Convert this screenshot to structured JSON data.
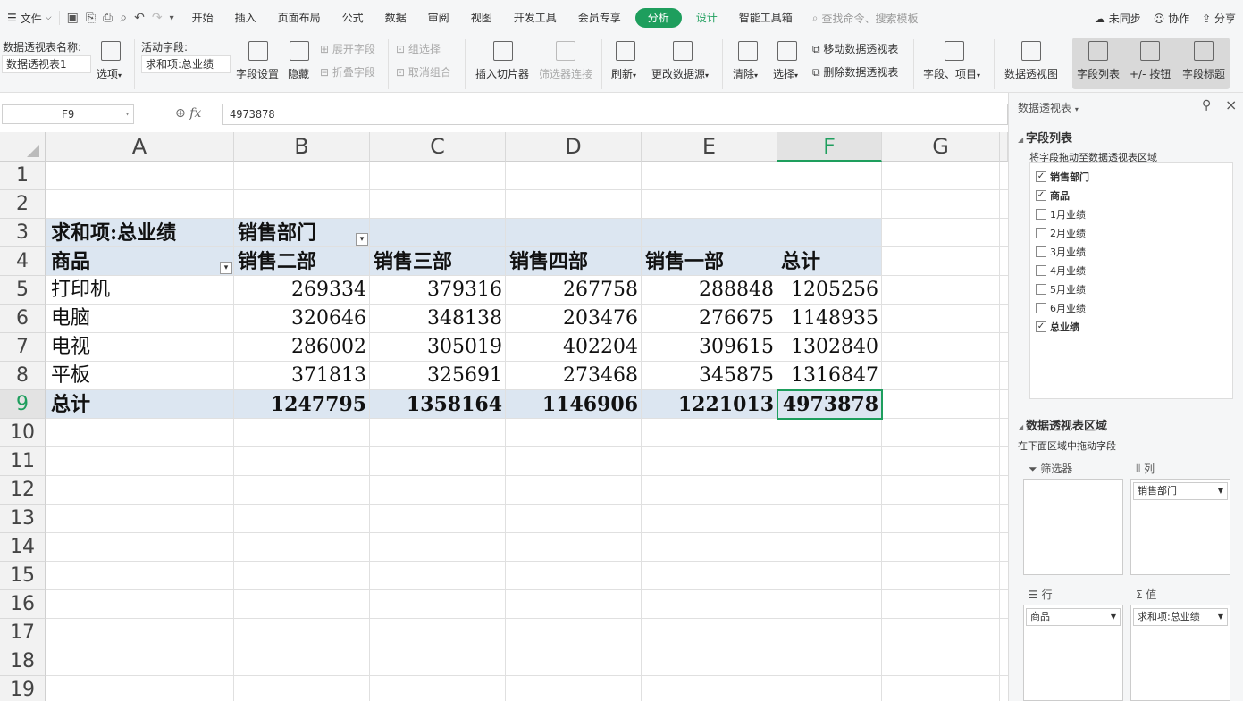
{
  "menubar": {
    "file_label": "文件",
    "tabs": [
      "开始",
      "插入",
      "页面布局",
      "公式",
      "数据",
      "审阅",
      "视图",
      "开发工具",
      "会员专享"
    ],
    "active_tab": "分析",
    "design_tab": "设计",
    "smart_tab": "智能工具箱",
    "search_placeholder": "查找命令、搜索模板",
    "sync": "未同步",
    "collab": "协作",
    "share": "分享"
  },
  "ribbon": {
    "pt_name_label": "数据透视表名称:",
    "pt_name_value": "数据透视表1",
    "options": "选项",
    "active_field_label": "活动字段:",
    "active_field_value": "求和项:总业绩",
    "field_settings": "字段设置",
    "hide": "隐藏",
    "expand_field": "展开字段",
    "collapse_field": "折叠字段",
    "group_selection": "组选择",
    "ungroup": "取消组合",
    "insert_slicer": "插入切片器",
    "filter_connection": "筛选器连接",
    "refresh": "刷新",
    "change_source": "更改数据源",
    "clear": "清除",
    "select": "选择",
    "move_pt": "移动数据透视表",
    "delete_pt": "删除数据透视表",
    "fields_items": "字段、项目",
    "pivot_chart": "数据透视图",
    "field_list": "字段列表",
    "plus_minus": "+/- 按钮",
    "field_headers": "字段标题"
  },
  "formula": {
    "cell_ref": "F9",
    "value": "4973878"
  },
  "columns": [
    "A",
    "B",
    "C",
    "D",
    "E",
    "F",
    "G"
  ],
  "rows": [
    "1",
    "2",
    "3",
    "4",
    "5",
    "6",
    "7",
    "8",
    "9",
    "10",
    "11",
    "12",
    "13",
    "14",
    "15",
    "16",
    "17",
    "18",
    "19"
  ],
  "pivot": {
    "sum_label": "求和项:总业绩",
    "col_field": "销售部门",
    "row_field": "商品",
    "headers": [
      "销售二部",
      "销售三部",
      "销售四部",
      "销售一部",
      "总计"
    ],
    "data": [
      [
        "打印机",
        "269334",
        "379316",
        "267758",
        "288848",
        "1205256"
      ],
      [
        "电脑",
        "320646",
        "348138",
        "203476",
        "276675",
        "1148935"
      ],
      [
        "电视",
        "286002",
        "305019",
        "402204",
        "309615",
        "1302840"
      ],
      [
        "平板",
        "371813",
        "325691",
        "273468",
        "345875",
        "1316847"
      ]
    ],
    "total": [
      "总计",
      "1247795",
      "1358164",
      "1146906",
      "1221013",
      "4973878"
    ]
  },
  "panel": {
    "title": "数据透视表",
    "field_list_title": "字段列表",
    "drag_hint": "将字段拖动至数据透视表区域",
    "fields": [
      {
        "name": "销售部门",
        "checked": true
      },
      {
        "name": "商品",
        "checked": true
      },
      {
        "name": "1月业绩",
        "checked": false
      },
      {
        "name": "2月业绩",
        "checked": false
      },
      {
        "name": "3月业绩",
        "checked": false
      },
      {
        "name": "4月业绩",
        "checked": false
      },
      {
        "name": "5月业绩",
        "checked": false
      },
      {
        "name": "6月业绩",
        "checked": false
      },
      {
        "name": "总业绩",
        "checked": true
      }
    ],
    "areas_title": "数据透视表区域",
    "areas_hint": "在下面区域中拖动字段",
    "filter_label": "筛选器",
    "column_label": "列",
    "row_label": "行",
    "value_label": "值",
    "column_item": "销售部门",
    "row_item": "商品",
    "value_item": "求和项:总业绩"
  }
}
